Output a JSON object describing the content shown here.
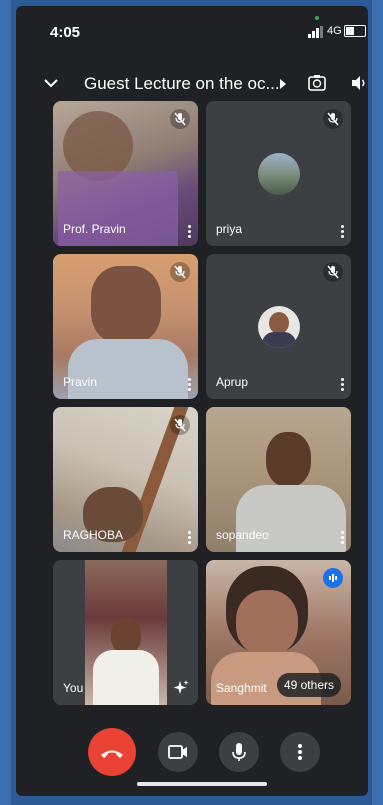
{
  "status_bar": {
    "time": "4:05",
    "network": "4G"
  },
  "header": {
    "title": "Guest Lecture on the oc..."
  },
  "tiles": [
    {
      "name": "Prof. Pravin",
      "muted": true
    },
    {
      "name": "priya",
      "muted": true
    },
    {
      "name": "Pravin",
      "muted": true
    },
    {
      "name": "Aprup",
      "muted": true
    },
    {
      "name": "RAGHOBA",
      "muted": true
    },
    {
      "name": "sopandeo",
      "muted": false
    },
    {
      "name": "You",
      "muted": false
    },
    {
      "name": "Sanghmit",
      "speaking": true,
      "others": "49 others"
    }
  ],
  "controls": {
    "end_call": "end-call-icon",
    "camera": "camera-icon",
    "mic": "mic-icon",
    "more": "more-vert-icon"
  },
  "colors": {
    "end_call": "#ea4335",
    "speaking": "#1a73e8",
    "background": "#202124",
    "tile": "#3c4043"
  }
}
